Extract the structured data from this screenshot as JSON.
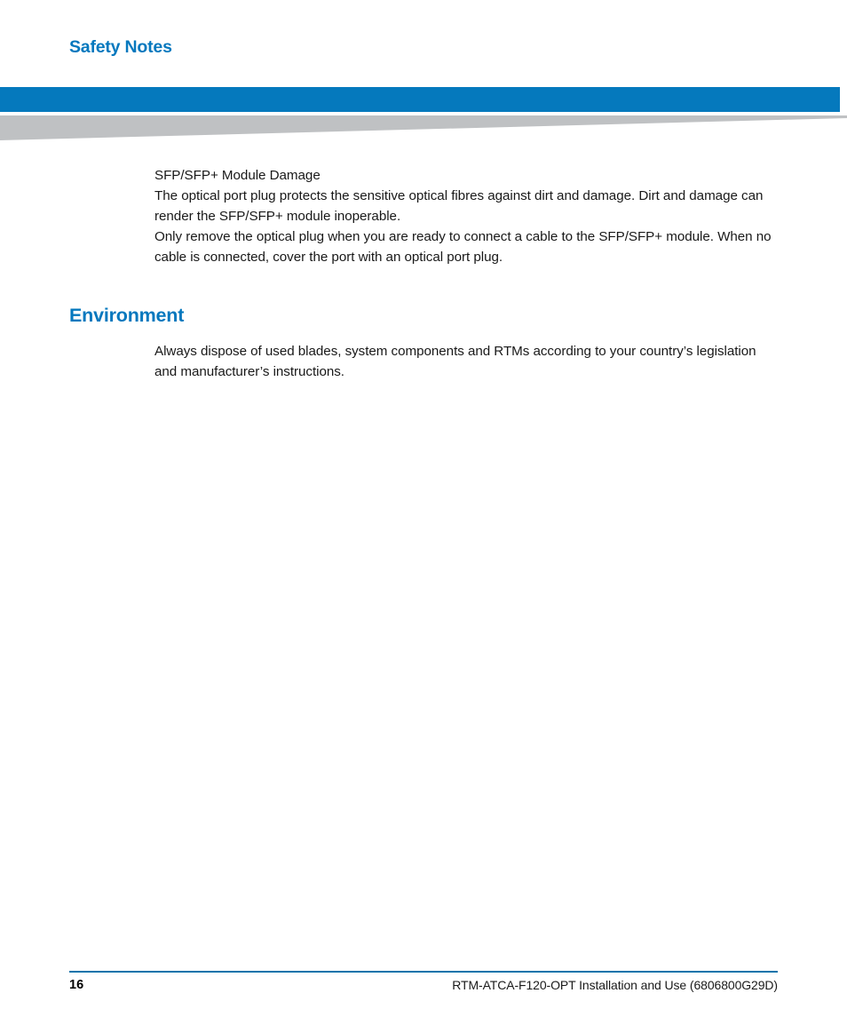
{
  "header": {
    "title": "Safety Notes",
    "accent_color": "#0578be",
    "bar_color": "#0579bd",
    "wedge_color": "#bfc1c3",
    "pattern_square_color": "#f3f3f3"
  },
  "content": {
    "notes_block": {
      "lines": [
        "SFP/SFP+ Module Damage",
        "The optical port plug protects the sensitive optical fibres against dirt and damage. Dirt and damage can render the SFP/SFP+ module inoperable.",
        "Only remove the optical plug when you are ready to connect a cable to the SFP/SFP+ module. When no cable is connected, cover the port with an optical port plug."
      ],
      "line_1": "SFP/SFP+ Module Damage",
      "line_2": "The optical port plug protects the sensitive optical fibres against dirt and damage. Dirt and damage can render the SFP/SFP+ module inoperable.",
      "line_3": "Only remove the optical plug when you are ready to connect a cable to the SFP/SFP+ module. When no cable is connected, cover the port with an optical port plug."
    },
    "environment_section": {
      "heading": "Environment",
      "paragraph": "Always dispose of used blades, system components and RTMs according to your country’s legislation and manufacturer’s instructions."
    }
  },
  "footer": {
    "page_number": "16",
    "document_title": "RTM-ATCA-F120-OPT Installation and Use (6806800G29D)",
    "rule_color": "#0c74ab"
  }
}
